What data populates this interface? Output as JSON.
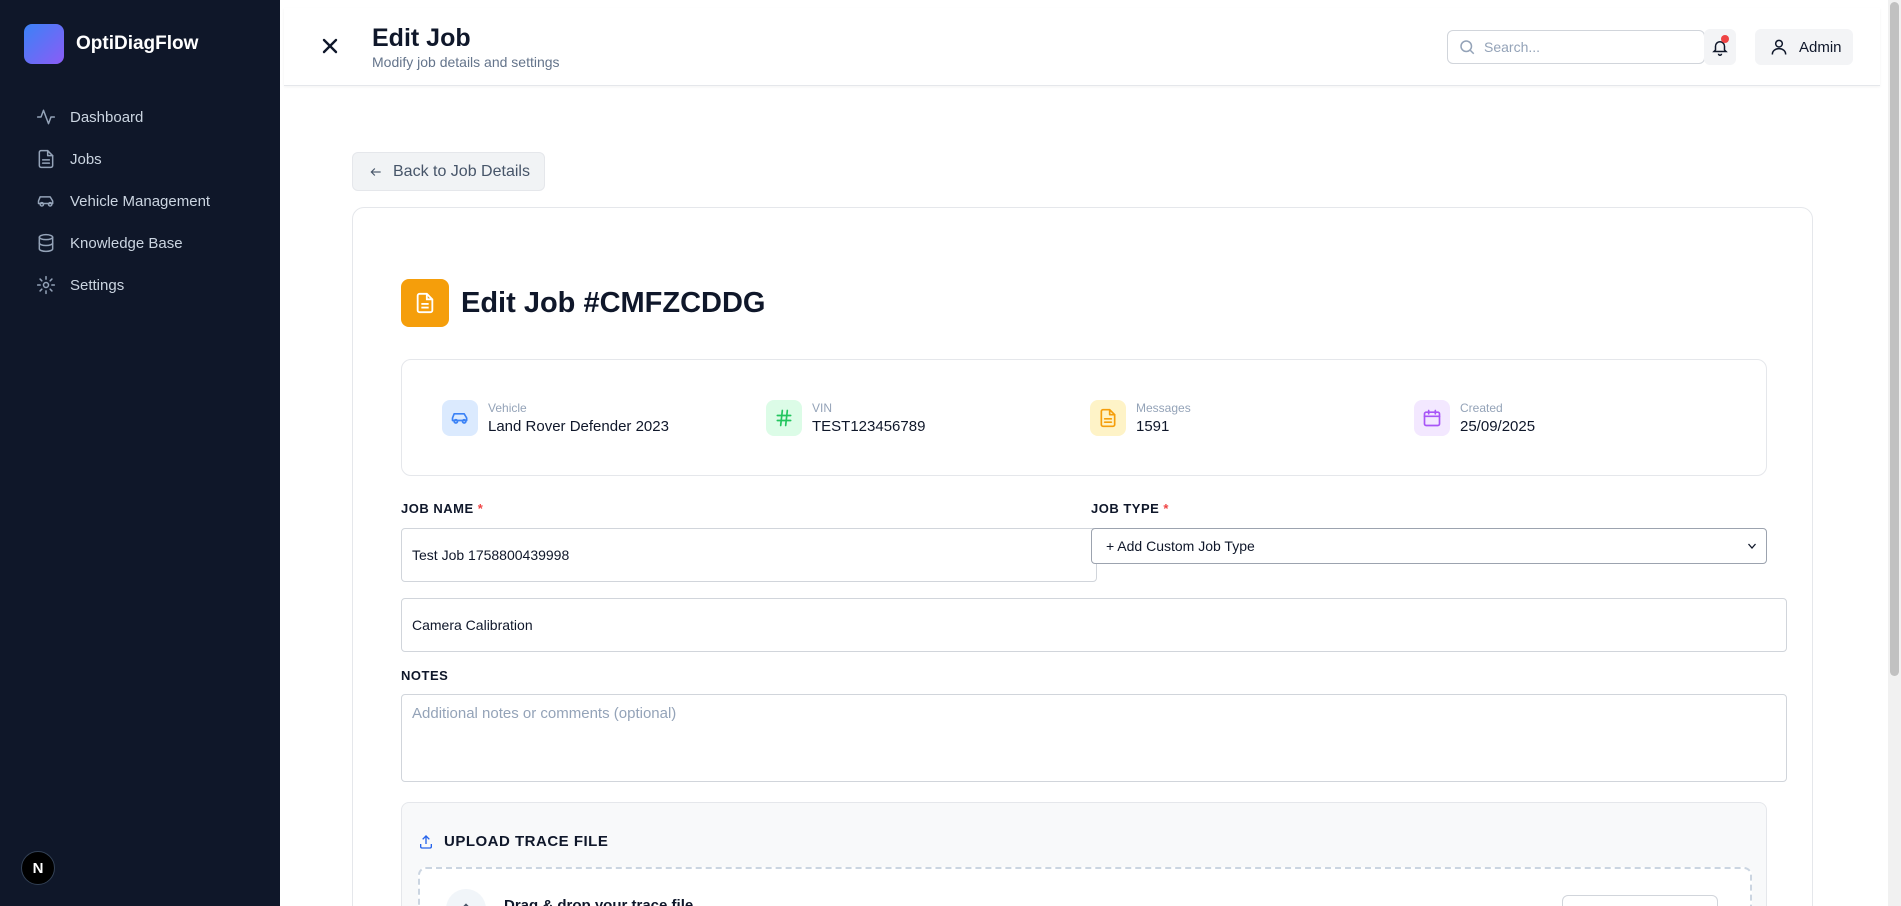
{
  "app": {
    "name": "OptiDiagFlow",
    "badge": "N"
  },
  "sidebar": {
    "items": [
      {
        "label": "Dashboard",
        "icon": "activity-icon"
      },
      {
        "label": "Jobs",
        "icon": "file-icon"
      },
      {
        "label": "Vehicle Management",
        "icon": "car-icon"
      },
      {
        "label": "Knowledge Base",
        "icon": "database-icon"
      },
      {
        "label": "Settings",
        "icon": "gear-icon"
      }
    ]
  },
  "header": {
    "title": "Edit Job",
    "subtitle": "Modify job details and settings",
    "search_placeholder": "Search...",
    "user_label": "Admin"
  },
  "back_label": "Back to Job Details",
  "job": {
    "title": "Edit Job #CMFZCDDG",
    "info": [
      {
        "label": "Vehicle",
        "value": "Land Rover Defender 2023",
        "icon": "car-icon",
        "color": "#3b82f6"
      },
      {
        "label": "VIN",
        "value": "TEST123456789",
        "icon": "hash-icon",
        "color": "#22c55e"
      },
      {
        "label": "Messages",
        "value": "1591",
        "icon": "document-icon",
        "color": "#f59e0b"
      },
      {
        "label": "Created",
        "value": "25/09/2025",
        "icon": "calendar-icon",
        "color": "#a855f7"
      }
    ]
  },
  "form": {
    "job_name_label": "JOB NAME",
    "job_name_value": "Test Job 1758800439998",
    "job_type_label": "JOB TYPE",
    "job_type_selected": "+ Add Custom Job Type",
    "custom_type_value": "Camera Calibration",
    "required_mark": "*",
    "notes_label": "NOTES",
    "notes_placeholder": "Additional notes or comments (optional)"
  },
  "upload": {
    "title": "UPLOAD TRACE FILE",
    "drop_text": "Drag & drop your trace file"
  },
  "colors": {
    "sidebar_bg": "#0f1729",
    "accent": "#f59e0b",
    "notification": "#ef4444"
  }
}
